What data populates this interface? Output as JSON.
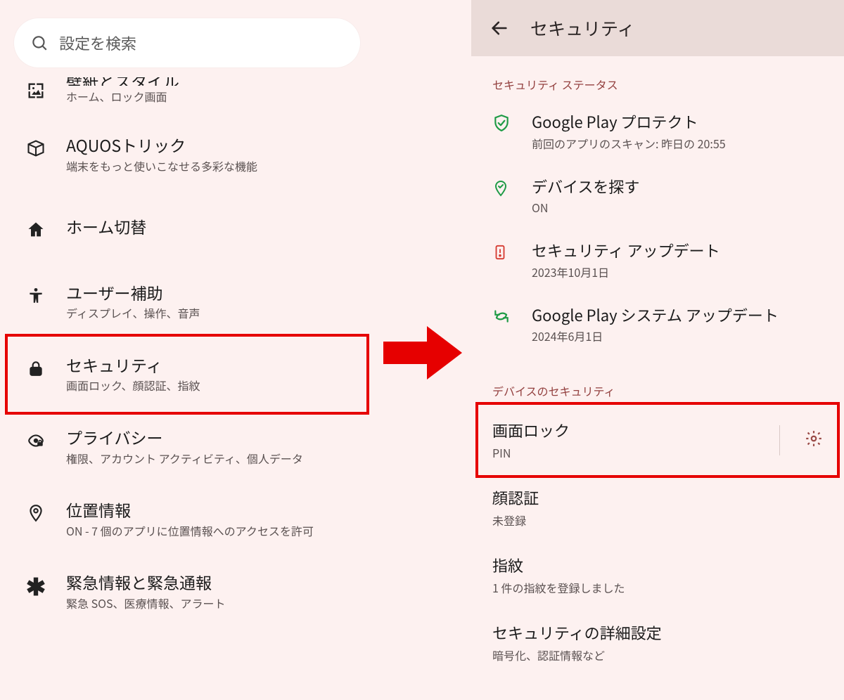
{
  "left": {
    "search_placeholder": "設定を検索",
    "items": [
      {
        "icon": "wallpaper",
        "title_cut": "壁紙とスタイル",
        "sub": "ホーム、ロック画面"
      },
      {
        "icon": "cube",
        "title": "AQUOSトリック",
        "sub": "端末をもっと使いこなせる多彩な機能"
      },
      {
        "icon": "home",
        "title": "ホーム切替",
        "sub": ""
      },
      {
        "icon": "accessibility",
        "title": "ユーザー補助",
        "sub": "ディスプレイ、操作、音声"
      },
      {
        "icon": "lock",
        "title": "セキュリティ",
        "sub": "画面ロック、顔認証、指紋"
      },
      {
        "icon": "privacy",
        "title": "プライバシー",
        "sub": "権限、アカウント アクティビティ、個人データ"
      },
      {
        "icon": "location",
        "title": "位置情報",
        "sub": "ON - 7 個のアプリに位置情報へのアクセスを許可"
      },
      {
        "icon": "emergency",
        "title": "緊急情報と緊急通報",
        "sub": "緊急 SOS、医療情報、アラート"
      }
    ]
  },
  "right": {
    "header": {
      "title": "セキュリティ"
    },
    "sections": {
      "status_label": "セキュリティ ステータス",
      "device_label": "デバイスのセキュリティ"
    },
    "status": [
      {
        "icon": "shield-check",
        "color": "#1e9b46",
        "title": "Google Play プロテクト",
        "sub": "前回のアプリのスキャン: 昨日の 20:55"
      },
      {
        "icon": "pin-check",
        "color": "#1e9b46",
        "title": "デバイスを探す",
        "sub": "ON"
      },
      {
        "icon": "warn-phone",
        "color": "#d63a30",
        "title": "セキュリティ アップデート",
        "sub": "2023年10月1日"
      },
      {
        "icon": "refresh",
        "color": "#1e9b46",
        "title": "Google Play システム アップデート",
        "sub": "2024年6月1日"
      }
    ],
    "device": [
      {
        "title": "画面ロック",
        "sub": "PIN",
        "gear": true
      },
      {
        "title": "顔認証",
        "sub": "未登録"
      },
      {
        "title": "指紋",
        "sub": "1 件の指紋を登録しました"
      },
      {
        "title": "セキュリティの詳細設定",
        "sub": "暗号化、認証情報など"
      }
    ]
  }
}
